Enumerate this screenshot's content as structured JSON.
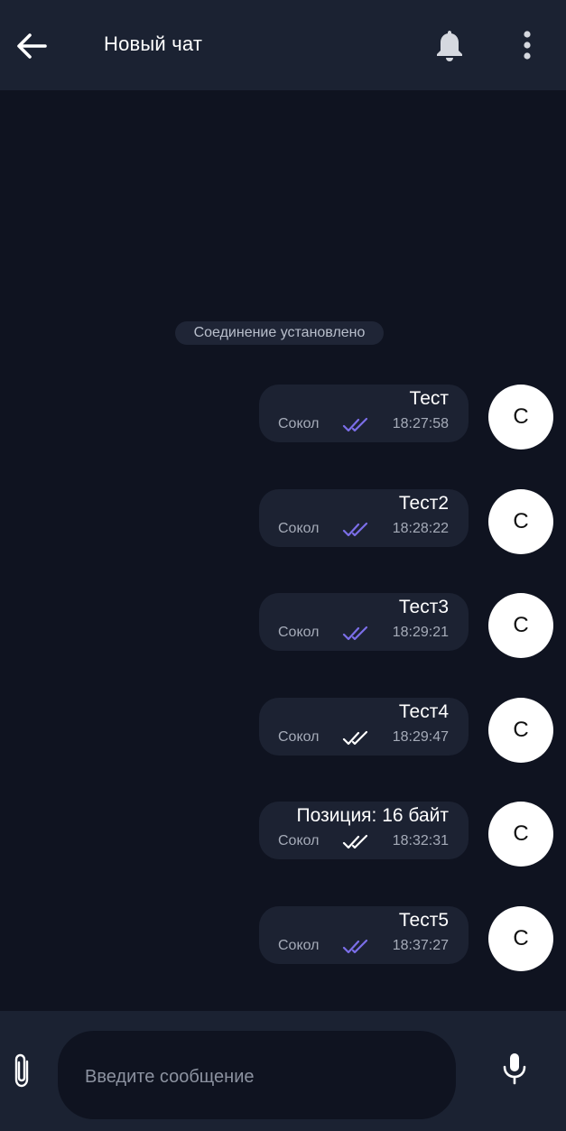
{
  "header": {
    "title": "Новый чат",
    "back_icon": "arrow-left-icon",
    "notifications_icon": "bell-icon",
    "menu_icon": "more-vertical-icon"
  },
  "system_notice": "Соединение установлено",
  "messages": [
    {
      "text": "Тест",
      "sender": "Сокол",
      "time": "18:27:58",
      "status": "read",
      "avatar_letter": "С"
    },
    {
      "text": "Тест2",
      "sender": "Сокол",
      "time": "18:28:22",
      "status": "read",
      "avatar_letter": "С"
    },
    {
      "text": "Тест3",
      "sender": "Сокол",
      "time": "18:29:21",
      "status": "read",
      "avatar_letter": "С"
    },
    {
      "text": "Тест4",
      "sender": "Сокол",
      "time": "18:29:47",
      "status": "delivered",
      "avatar_letter": "С"
    },
    {
      "text": "Позиция: 16 байт",
      "sender": "Сокол",
      "time": "18:32:31",
      "status": "delivered",
      "avatar_letter": "С"
    },
    {
      "text": "Тест5",
      "sender": "Сокол",
      "time": "18:37:27",
      "status": "read",
      "avatar_letter": "С"
    }
  ],
  "composer": {
    "placeholder": "Введите сообщение",
    "value": "",
    "attach_icon": "paperclip-icon",
    "mic_icon": "microphone-icon"
  },
  "colors": {
    "background": "#0f1320",
    "bar": "#1b2232",
    "bubble": "#1c2232",
    "check_read": "#7b6ee8",
    "check_delivered": "#ffffff"
  }
}
